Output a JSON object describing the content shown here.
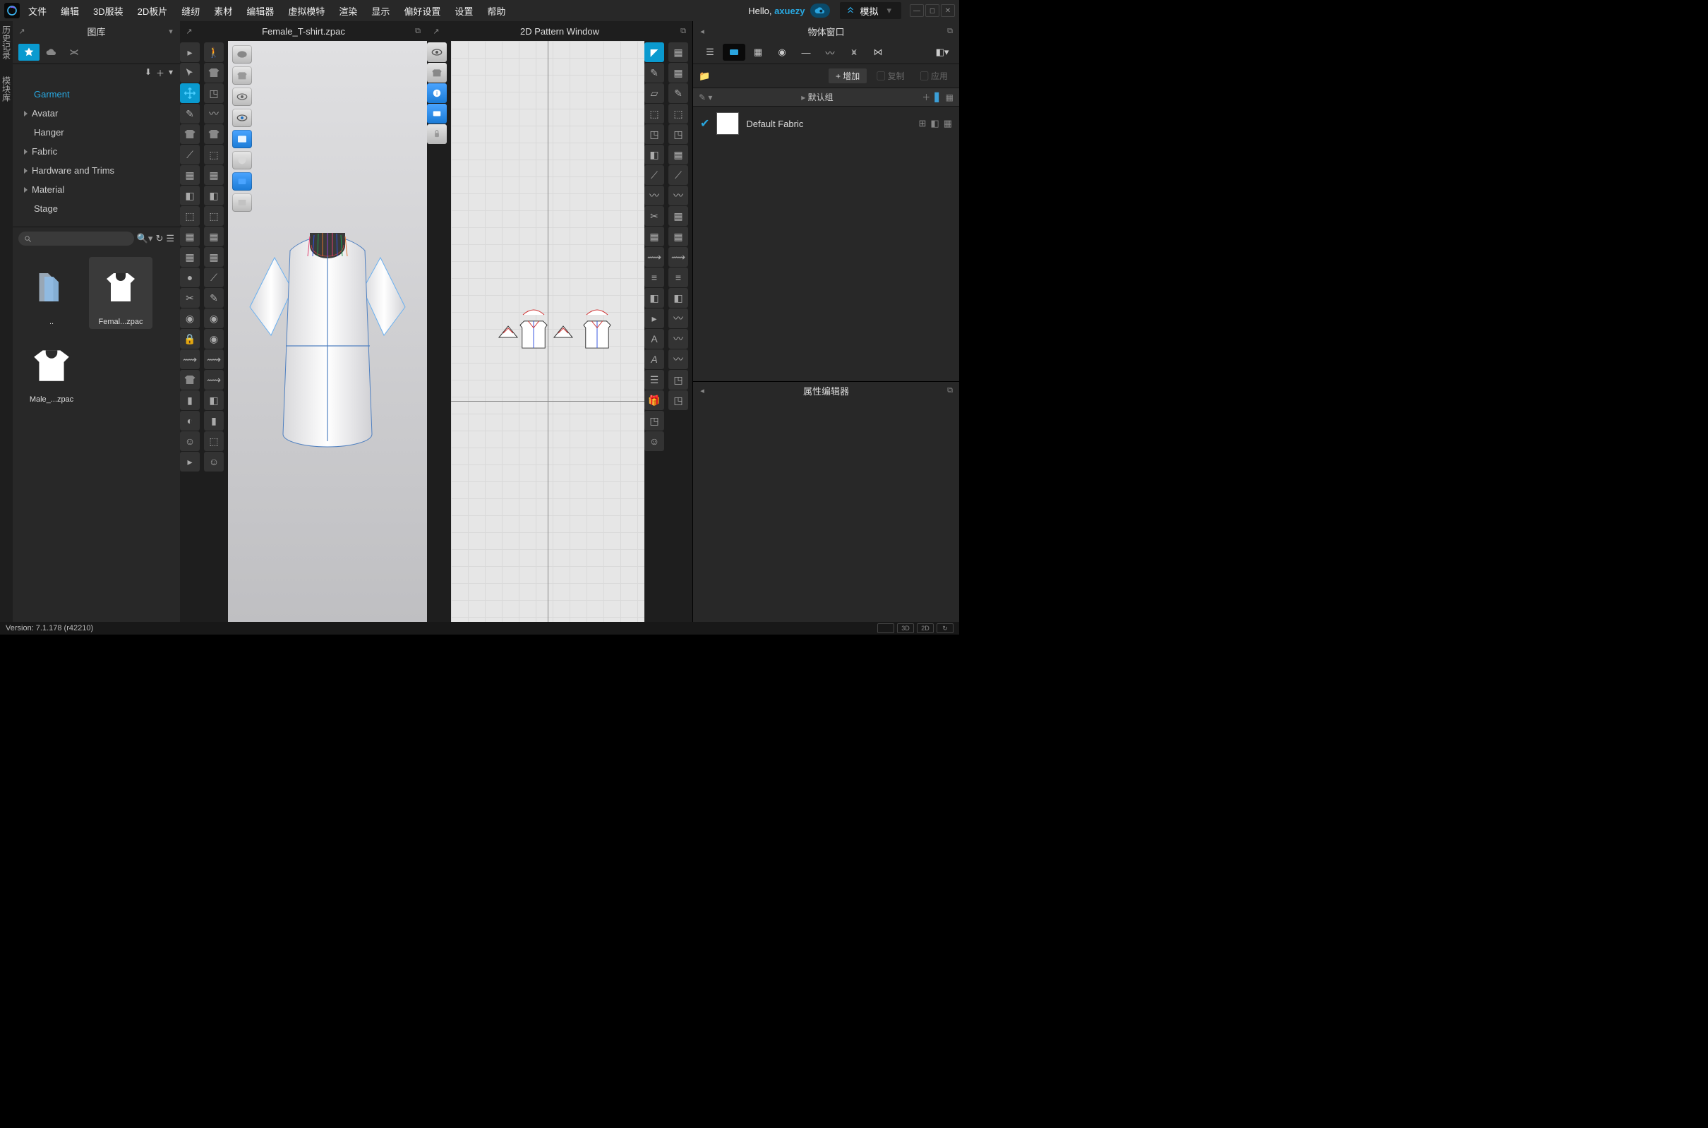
{
  "menu": {
    "file": "文件",
    "edit": "编辑",
    "garment3d": "3D服装",
    "pattern2d": "2D板片",
    "sewing": "缝纫",
    "material": "素材",
    "editor": "编辑器",
    "avatar": "虚拟模特",
    "render": "渲染",
    "display": "显示",
    "preferences": "偏好设置",
    "settings": "设置",
    "help": "帮助"
  },
  "hello_prefix": "Hello, ",
  "hello_user": "axuezy",
  "simulate": "模拟",
  "left_tabs": {
    "history": "历史记录",
    "module": "模块库"
  },
  "library": {
    "title": "图库",
    "tree": {
      "garment": "Garment",
      "avatar": "Avatar",
      "hanger": "Hanger",
      "fabric": "Fabric",
      "hardware": "Hardware and Trims",
      "material": "Material",
      "stage": "Stage"
    },
    "search_placeholder": "",
    "thumbs": {
      "up": "..",
      "t1": "Femal...zpac",
      "t2": "Male_...zpac"
    }
  },
  "view3d_title": "Female_T-shirt.zpac",
  "view2d_title": "2D Pattern Window",
  "right": {
    "title": "物体窗口",
    "add": "+ 增加",
    "copy": "复制",
    "apply": "应用",
    "group_title": "默认组",
    "fabric_name": "Default Fabric",
    "prop_title": "属性编辑器"
  },
  "status": {
    "version": "Version: 7.1.178 (r42210)",
    "btn3d": "3D",
    "btn2d": "2D"
  }
}
